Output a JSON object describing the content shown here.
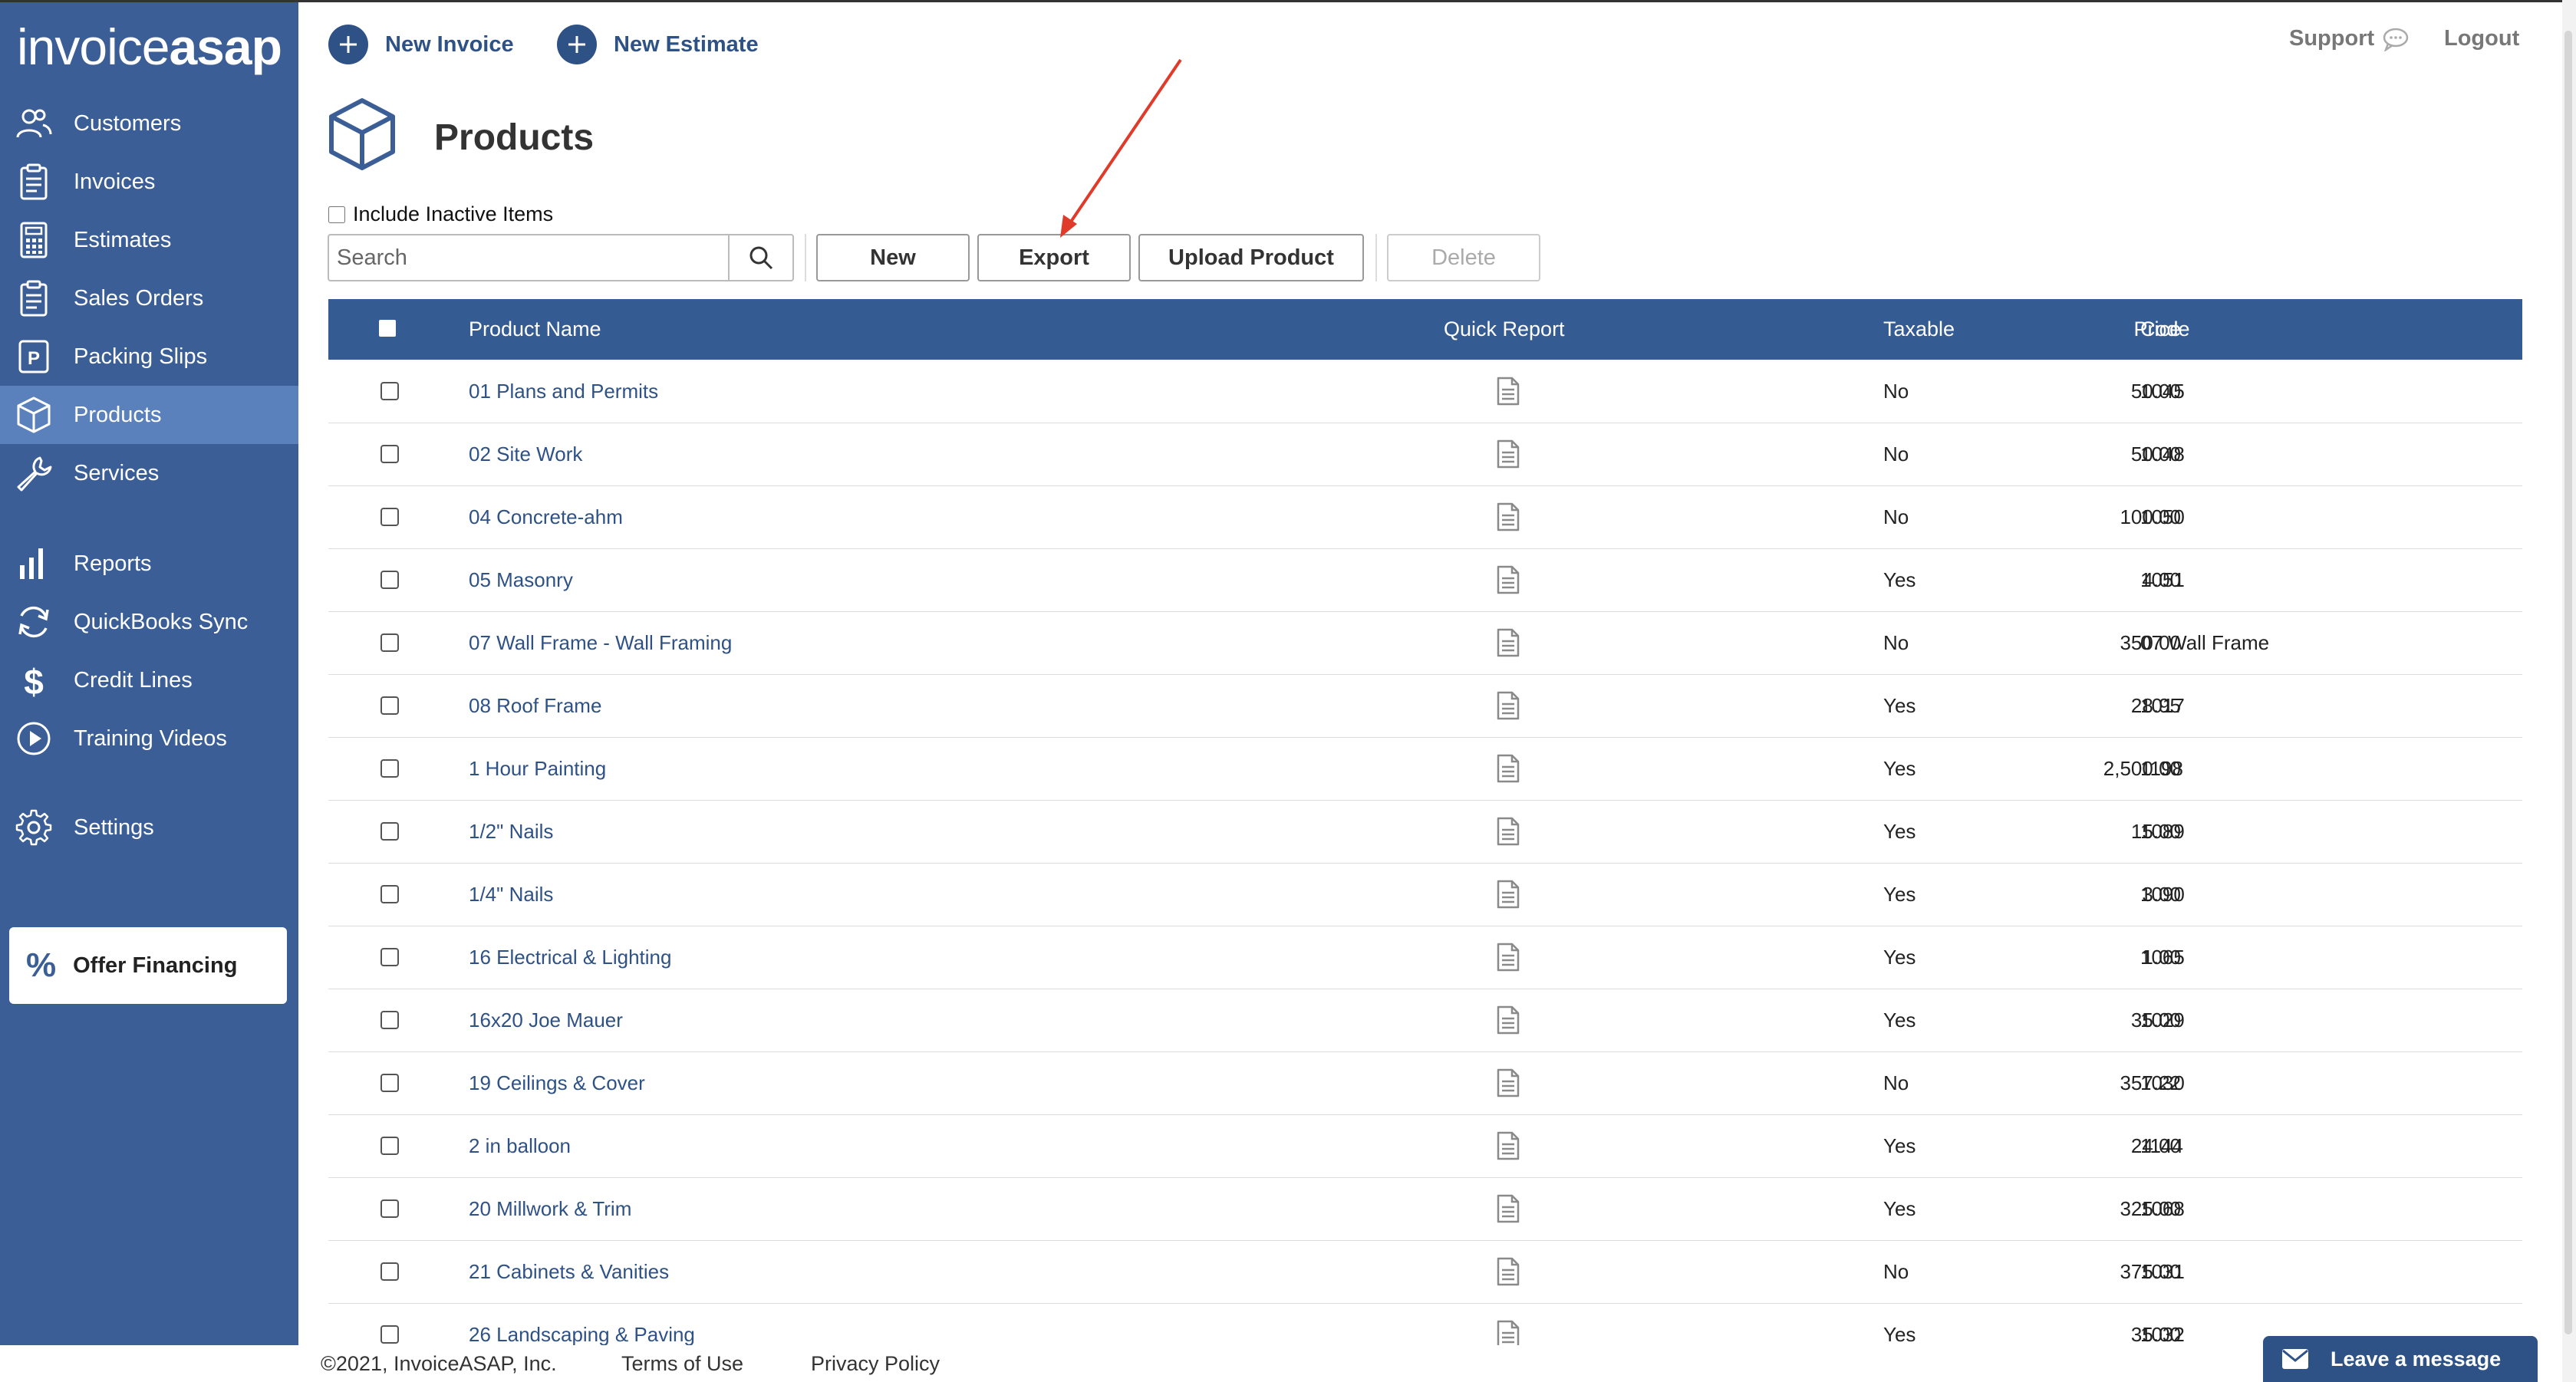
{
  "brand": {
    "part1": "invoice",
    "part2": "asap"
  },
  "sidebar": {
    "items": [
      {
        "label": "Customers",
        "icon": "users-icon"
      },
      {
        "label": "Invoices",
        "icon": "clipboard-icon"
      },
      {
        "label": "Estimates",
        "icon": "calculator-icon"
      },
      {
        "label": "Sales Orders",
        "icon": "clipboard-icon"
      },
      {
        "label": "Packing Slips",
        "icon": "packing-slip-icon"
      },
      {
        "label": "Products",
        "icon": "box-icon",
        "active": true
      },
      {
        "label": "Services",
        "icon": "wrench-icon"
      },
      {
        "label": "Reports",
        "icon": "bar-chart-icon"
      },
      {
        "label": "QuickBooks Sync",
        "icon": "sync-icon"
      },
      {
        "label": "Credit Lines",
        "icon": "dollar-icon"
      },
      {
        "label": "Training Videos",
        "icon": "play-icon"
      },
      {
        "label": "Settings",
        "icon": "gear-icon"
      }
    ],
    "offer": {
      "symbol": "%",
      "label": "Offer Financing"
    }
  },
  "header": {
    "new_invoice": "New Invoice",
    "new_estimate": "New Estimate",
    "support": "Support",
    "logout": "Logout"
  },
  "page": {
    "title": "Products",
    "include_inactive": "Include Inactive Items",
    "search_placeholder": "Search"
  },
  "toolbar": {
    "new": "New",
    "export": "Export",
    "upload": "Upload Product",
    "delete": "Delete"
  },
  "table": {
    "columns": {
      "name": "Product Name",
      "quick_report": "Quick Report",
      "price": "Price",
      "taxable": "Taxable",
      "code": "Code"
    },
    "rows": [
      {
        "name": "01 Plans and Permits",
        "price": "50.00",
        "taxable": "No",
        "code": "1045"
      },
      {
        "name": "02 Site Work",
        "price": "50.00",
        "taxable": "No",
        "code": "1048"
      },
      {
        "name": "04 Concrete-ahm",
        "price": "100.00",
        "taxable": "No",
        "code": "1050"
      },
      {
        "name": "05 Masonry",
        "price": "4.00",
        "taxable": "Yes",
        "code": "1051"
      },
      {
        "name": "07 Wall Frame - Wall Framing",
        "price": "350.00",
        "taxable": "No",
        "code": "07 Wall Frame"
      },
      {
        "name": "08 Roof Frame",
        "price": "28.95",
        "taxable": "Yes",
        "code": "1017"
      },
      {
        "name": "1 Hour Painting",
        "price": "2,500.00",
        "taxable": "Yes",
        "code": "1198"
      },
      {
        "name": "1/2\" Nails",
        "price": "15.00",
        "taxable": "Yes",
        "code": "1089"
      },
      {
        "name": "1/4\" Nails",
        "price": "3.00",
        "taxable": "Yes",
        "code": "1090"
      },
      {
        "name": "16 Electrical & Lighting",
        "price": "1.00",
        "taxable": "Yes",
        "code": "1065"
      },
      {
        "name": "16x20 Joe Mauer",
        "price": "35.00",
        "taxable": "Yes",
        "code": "1029"
      },
      {
        "name": "19 Ceilings & Cover",
        "price": "357.22",
        "taxable": "No",
        "code": "1030"
      },
      {
        "name": "2 in balloon",
        "price": "24.00",
        "taxable": "Yes",
        "code": "1144"
      },
      {
        "name": "20 Millwork & Trim",
        "price": "325.00",
        "taxable": "Yes",
        "code": "1068"
      },
      {
        "name": "21 Cabinets & Vanities",
        "price": "375.00",
        "taxable": "No",
        "code": "1031"
      },
      {
        "name": "26 Landscaping & Paving",
        "price": "35.00",
        "taxable": "Yes",
        "code": "1032"
      }
    ]
  },
  "footer": {
    "copyright": "©2021, InvoiceASAP, Inc.",
    "terms": "Terms of Use",
    "privacy": "Privacy Policy"
  },
  "chat": {
    "label": "Leave a message"
  },
  "colors": {
    "sidebar": "#3a5e95",
    "active": "#5b81bd",
    "accent": "#2e5186",
    "annotation_arrow": "#e03a2a"
  }
}
